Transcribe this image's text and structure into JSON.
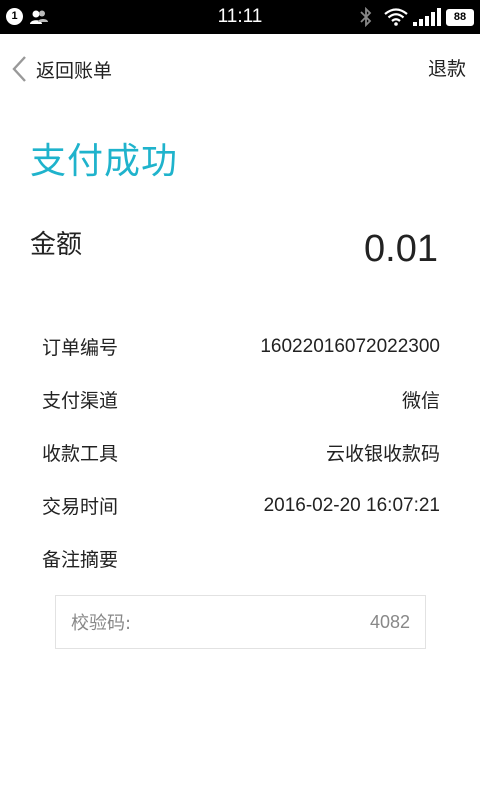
{
  "status_bar": {
    "notification_count": "1",
    "time": "11:11",
    "battery": "88",
    "icons": [
      "contacts-icon",
      "bluetooth-icon",
      "wifi-icon",
      "signal-icon"
    ]
  },
  "nav": {
    "back_label": "返回账单",
    "refund_label": "退款"
  },
  "title": "支付成功",
  "amount": {
    "label": "金额",
    "value": "0.01"
  },
  "details": [
    {
      "label": "订单编号",
      "value": "16022016072022300"
    },
    {
      "label": "支付渠道",
      "value": "微信"
    },
    {
      "label": "收款工具",
      "value": "云收银收款码"
    },
    {
      "label": "交易时间",
      "value": "2016-02-20 16:07:21"
    },
    {
      "label": "备注摘要",
      "value": ""
    }
  ],
  "verify": {
    "label": "校验码:",
    "value": "4082"
  },
  "colors": {
    "accent": "#1fb3cc",
    "status_bar": "#000000",
    "text": "#222222",
    "muted": "#888888"
  }
}
